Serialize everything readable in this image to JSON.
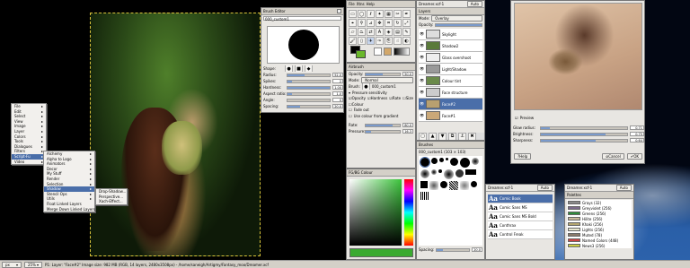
{
  "brush_editor": {
    "title": "Brush Editor",
    "name": "000_custom1",
    "shape_label": "Shape:",
    "rows": [
      {
        "label": "Radius:",
        "value": "52.0",
        "p": 0.4
      },
      {
        "label": "Spikes:",
        "value": "2",
        "p": 0.1
      },
      {
        "label": "Hardness:",
        "value": "1.00",
        "p": 1.0
      },
      {
        "label": "Aspect ratio:",
        "value": "1.0",
        "p": 0.1
      },
      {
        "label": "Angle:",
        "value": "0",
        "p": 0.0
      },
      {
        "label": "Spacing:",
        "value": "20.0",
        "p": 0.3
      }
    ]
  },
  "toolbox": {
    "title": "Toolbox",
    "menu": [
      "File",
      "Xtns",
      "Help"
    ]
  },
  "airbrush": {
    "title": "Airbrush",
    "opacity_label": "Opacity:",
    "opacity": "50.0",
    "mode_label": "Mode:",
    "mode": "Normal",
    "brush_label": "Brush:",
    "brush": "000_custom1",
    "pressure_label": "Pressure sensitivity",
    "opts": [
      "Opacity",
      "Hardness",
      "Rate",
      "Size",
      "Colour"
    ],
    "fade": "Fade out",
    "gradient": "Use colour from gradient",
    "rate_label": "Rate:",
    "rate": "80.0",
    "pressure2_label": "Pressure:",
    "pressure2": "16.3"
  },
  "fg_color": {
    "title": "FG/BG Colour"
  },
  "layers_panel": {
    "title": "Layers",
    "image": "Dreamer.xcf-1",
    "auto": "Auto",
    "mode_label": "Mode:",
    "mode": "Overlay",
    "opacity_label": "Opacity:",
    "opacity": "",
    "layers": [
      "Skylight",
      "Shadow2",
      "Glass overshoot",
      "Light/Shadow",
      "Colour tint",
      "Face structure",
      "Face#2",
      "Face#1"
    ]
  },
  "brushes_panel": {
    "title": "Brushes",
    "brush_name": "000_custom1 (103 × 103)",
    "spacing_label": "Spacing:",
    "spacing": "20.0"
  },
  "statusbar": {
    "unit": "px",
    "zoom": "25%",
    "info": "P1: Layer: \"Face#2\"   Image size: 982 MB (RGB, 14 layers, 2480x3508px) - /home/saneigh/Artigmy/Fantasy_moo/Dreamer.xcf"
  },
  "main_menu": {
    "items": [
      "File",
      "Edit",
      "Select",
      "View",
      "Image",
      "Layer",
      "Colors",
      "Tools",
      "Dialogues",
      "Filters",
      "Script-Fu",
      "Video"
    ],
    "selected": "Script-Fu"
  },
  "submenu1": {
    "items": [
      "Alchemy",
      "Alpha to Logo",
      "Animators",
      "Decor",
      "My Stuff",
      "Render",
      "Selection",
      "Shadow",
      "Stencil Ops",
      "Utils",
      "Float Linked Layers",
      "Merge Down Linked Layers"
    ],
    "selected": "Shadow"
  },
  "submenu2": {
    "items": [
      "Drop-Shadow...",
      "Perspective...",
      "Xach-Effect..."
    ]
  },
  "fonts_window": {
    "title": "Dreamer.xcf-1",
    "auto": "Auto",
    "fonts": [
      "Comic Book",
      "Comic Sans MS",
      "Comic Sans MS Bold",
      "Conthrax",
      "Control Freak"
    ],
    "selected": "Comic Book"
  },
  "palettes_window": {
    "title": "Dreamer.xcf-1",
    "auto": "Auto",
    "tab": "Palettes",
    "items": [
      {
        "name": "Grays (32)",
        "color": "#8a8a8a"
      },
      {
        "name": "Greyviolet (256)",
        "color": "#7a6a8a"
      },
      {
        "name": "Greens (256)",
        "color": "#2e8b3a"
      },
      {
        "name": "Hilite (256)",
        "color": "#c8b89a"
      },
      {
        "name": "Khaki (256)",
        "color": "#b4a670"
      },
      {
        "name": "Lights (256)",
        "color": "#e8e8d0"
      },
      {
        "name": "Muted (78)",
        "color": "#8a7a6a"
      },
      {
        "name": "Named Colors (448)",
        "color": "#cc4444"
      },
      {
        "name": "News3 (256)",
        "color": "#cccc44"
      }
    ]
  },
  "softglow_dialog": {
    "preview_label": "Preview",
    "rows": [
      {
        "label": "Glow radius:",
        "value": "0.71",
        "p": 0.1
      },
      {
        "label": "Brightness:",
        "value": "0.75",
        "p": 0.75
      },
      {
        "label": "Sharpness:",
        "value": "0.64",
        "p": 0.64
      }
    ],
    "help": "Help",
    "cancel": "Cancel",
    "ok": "OK"
  }
}
